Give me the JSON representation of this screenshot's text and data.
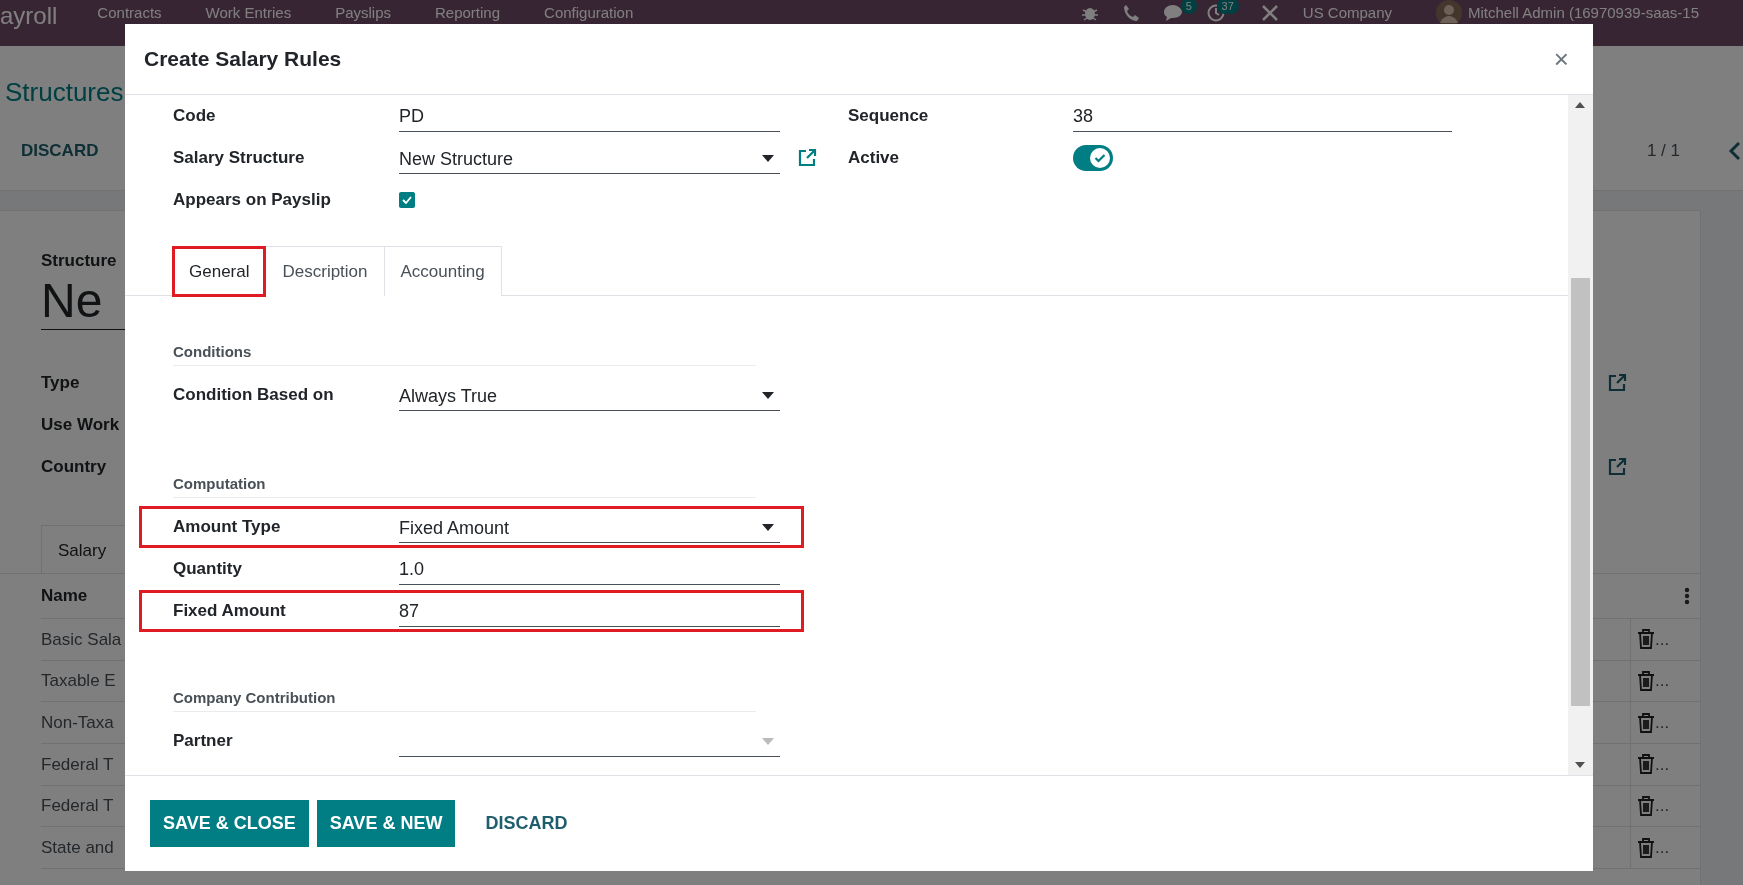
{
  "navbar": {
    "app": "ayroll",
    "menus": [
      "Contracts",
      "Work Entries",
      "Payslips",
      "Reporting",
      "Configuration"
    ],
    "chat_count": "5",
    "activity_count": "37",
    "company": "US Company",
    "user": "Mitchell Admin (16970939-saas-15"
  },
  "background": {
    "breadcrumb": "Structures",
    "discard": "DISCARD",
    "pager": "1 / 1",
    "structure_label": "Structure",
    "structure_name": "Ne",
    "fields": [
      {
        "label": "Type",
        "external_link": true
      },
      {
        "label": "Use Work",
        "external_link": false
      },
      {
        "label": "Country",
        "external_link": true
      }
    ],
    "tab": "Salary",
    "name_column": "Name",
    "rows": [
      {
        "name": "Basic Sala",
        "action": "..."
      },
      {
        "name": "Taxable E",
        "action": "..."
      },
      {
        "name": "Non-Taxa",
        "action": "..."
      },
      {
        "name": "Federal T",
        "action": "..."
      },
      {
        "name": "Federal T",
        "action": "..."
      },
      {
        "name": "State and",
        "action": "..."
      }
    ]
  },
  "dialog": {
    "title": "Create Salary Rules",
    "close_symbol": "×",
    "left_fields": [
      {
        "label": "Code",
        "kind": "text",
        "value": "PD"
      },
      {
        "label": "Salary Structure",
        "kind": "select",
        "value": "New Structure",
        "external_link": true
      },
      {
        "label": "Appears on Payslip",
        "kind": "checkbox",
        "checked": true
      }
    ],
    "right_fields": [
      {
        "label": "Sequence",
        "kind": "text",
        "value": "38"
      },
      {
        "label": "Active",
        "kind": "toggle",
        "on": true
      }
    ],
    "tabs": [
      {
        "label": "General",
        "selected": true,
        "highlighted": true
      },
      {
        "label": "Description",
        "selected": false,
        "highlighted": false
      },
      {
        "label": "Accounting",
        "selected": false,
        "highlighted": false
      }
    ],
    "sections": [
      {
        "title": "Conditions",
        "fields": [
          {
            "label": "Condition Based on",
            "kind": "select",
            "value": "Always True",
            "highlighted": false
          }
        ]
      },
      {
        "title": "Computation",
        "fields": [
          {
            "label": "Amount Type",
            "kind": "select",
            "value": "Fixed Amount",
            "highlighted": true
          },
          {
            "label": "Quantity",
            "kind": "text",
            "value": "1.0",
            "highlighted": false
          },
          {
            "label": "Fixed Amount",
            "kind": "text",
            "value": "87",
            "highlighted": true
          }
        ]
      },
      {
        "title": "Company Contribution",
        "fields": [
          {
            "label": "Partner",
            "kind": "select",
            "highlighted": false
          }
        ]
      }
    ],
    "buttons": [
      {
        "label": "SAVE & CLOSE",
        "kind": "primary"
      },
      {
        "label": "SAVE & NEW",
        "kind": "primary"
      },
      {
        "label": "DISCARD",
        "kind": "link"
      }
    ]
  }
}
